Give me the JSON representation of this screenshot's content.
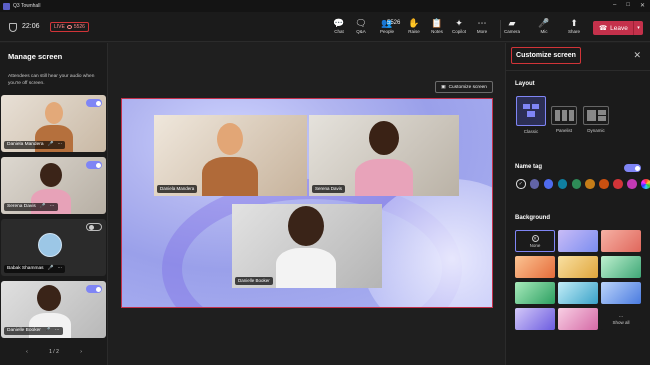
{
  "app": {
    "title": "Q3 Townhall"
  },
  "toolbar": {
    "timer": "22:06",
    "live_label": "LIVE",
    "viewer_count": "5526",
    "items": [
      {
        "label": "Chat",
        "icon": "chat-icon"
      },
      {
        "label": "Q&A",
        "icon": "qa-icon"
      },
      {
        "label": "People",
        "icon": "people-icon"
      },
      {
        "label": "Raise",
        "icon": "raise-hand-icon"
      },
      {
        "label": "Notes",
        "icon": "notes-icon"
      },
      {
        "label": "Copilot",
        "icon": "copilot-icon"
      },
      {
        "label": "More",
        "icon": "more-icon"
      },
      {
        "label": "Camera",
        "icon": "camera-icon"
      },
      {
        "label": "Mic",
        "icon": "mic-icon"
      },
      {
        "label": "Share",
        "icon": "share-icon"
      }
    ],
    "people_count": "5526",
    "leave_label": "Leave"
  },
  "manage_panel": {
    "title": "Manage screen",
    "note": "Attendees can still hear your audio when you're off screen.",
    "tiles": [
      {
        "name": "Daniela Mandera",
        "on_screen": true
      },
      {
        "name": "Serena Davis",
        "on_screen": true
      },
      {
        "name": "Babak Shammas",
        "on_screen": false
      },
      {
        "name": "Danielle Booker",
        "on_screen": true
      }
    ],
    "pager": {
      "prev": "‹",
      "label": "1 / 2",
      "next": "›"
    }
  },
  "stage": {
    "customize_button": "Customize screen",
    "videos": [
      {
        "name": "Daniela Mandera"
      },
      {
        "name": "Serena Davis"
      },
      {
        "name": "Danielle Booker"
      }
    ]
  },
  "customize_panel": {
    "title": "Customize screen",
    "layout_title": "Layout",
    "layouts": [
      {
        "label": "Classic",
        "selected": true
      },
      {
        "label": "Panelist",
        "selected": false
      },
      {
        "label": "Dynamic",
        "selected": false
      }
    ],
    "name_tag_title": "Name tag",
    "name_tag_enabled": true,
    "swatches": [
      "#2b2b2b",
      "#6264a7",
      "#4f6bed",
      "#0f7fa0",
      "#2e8b57",
      "#c57d18",
      "#ca5010",
      "#d13438",
      "#c239b3",
      "rainbow"
    ],
    "background_title": "Background",
    "backgrounds": [
      {
        "label": "None",
        "colors": [
          "#1b1b1b",
          "#1b1b1b"
        ]
      },
      {
        "label": "",
        "colors": [
          "#b5a6f3",
          "#7b8df0"
        ]
      },
      {
        "label": "",
        "colors": [
          "#f29a8a",
          "#e0675c"
        ]
      },
      {
        "label": "",
        "colors": [
          "#f8b27a",
          "#e66c3a"
        ]
      },
      {
        "label": "",
        "colors": [
          "#f7d68a",
          "#e0a63c"
        ]
      },
      {
        "label": "",
        "colors": [
          "#9de0b7",
          "#3fa877"
        ]
      },
      {
        "label": "",
        "colors": [
          "#87e0a0",
          "#2c9f61"
        ]
      },
      {
        "label": "",
        "colors": [
          "#a7e3f2",
          "#3aa2c8"
        ]
      },
      {
        "label": "",
        "colors": [
          "#9fc0f5",
          "#4a7be0"
        ]
      },
      {
        "label": "",
        "colors": [
          "#b8a8f4",
          "#6c5ce0"
        ]
      },
      {
        "label": "",
        "colors": [
          "#f4b6d6",
          "#d56aa6"
        ]
      },
      {
        "label": "Show all",
        "colors": [
          "#1b1b1b",
          "#1b1b1b"
        ]
      }
    ]
  }
}
